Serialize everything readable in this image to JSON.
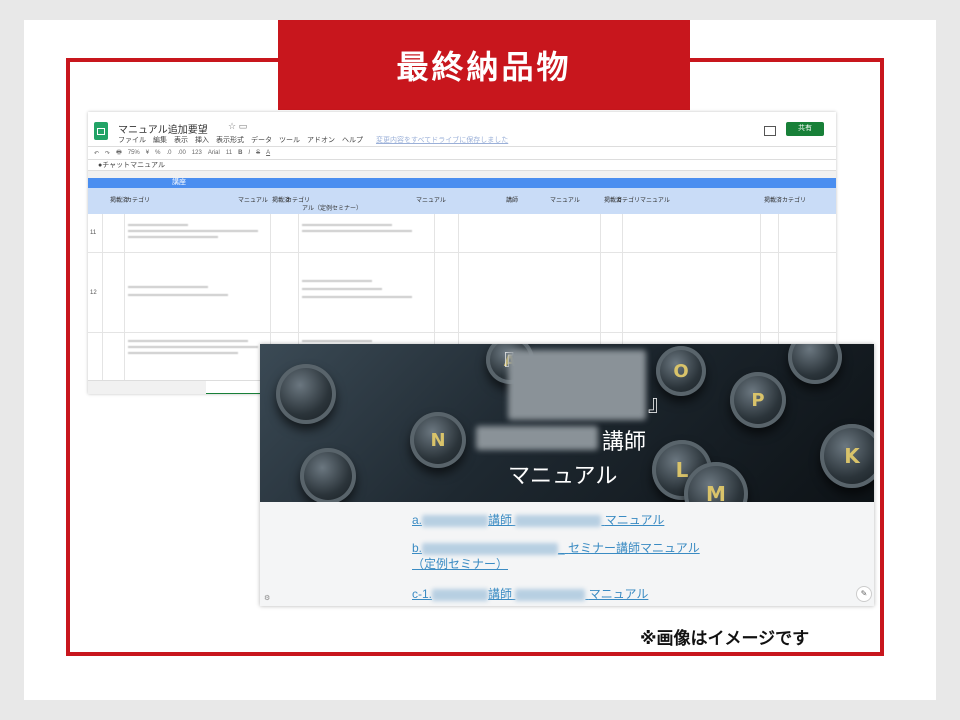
{
  "slide": {
    "title": "最終納品物",
    "note": "※画像はイメージです",
    "colors": {
      "accent": "#c8161d",
      "sheet_blue": "#4a8ef0",
      "link": "#3a8bc3"
    }
  },
  "spreadsheet": {
    "doc_title": "マニュアル追加要望",
    "menu": [
      "ファイル",
      "編集",
      "表示",
      "挿入",
      "表示形式",
      "データ",
      "ツール",
      "アドオン",
      "ヘルプ"
    ],
    "save_note": "変更内容をすべてドライブに保存しました",
    "share_label": "共有",
    "toolbar_items": [
      "↶",
      "↷",
      "🖶",
      "75%",
      "¥",
      "%",
      ".0",
      ".00",
      "123",
      "Arial",
      "11",
      "B",
      "I",
      "S",
      "A"
    ],
    "formula_text": "●チャットマニュアル",
    "section_row": "講座",
    "header_cells": [
      "掲載済",
      "カテゴリ",
      "マニュアル",
      "掲載済",
      "カテゴリ",
      "マニュアル",
      "講師",
      "マニュアル",
      "掲載済",
      "カテゴリ",
      "マニュアル",
      "掲載済",
      "カテゴリ"
    ],
    "header_subtitle": "アル（定例セミナー）",
    "row_numbers": [
      "11",
      "12"
    ]
  },
  "website": {
    "hero_line1_open": "『",
    "hero_line1_close": "』",
    "hero_line2": "講師",
    "hero_line3": "マニュアル",
    "keys": [
      "O",
      "P",
      "L",
      "A",
      "N",
      "M",
      "K"
    ],
    "links": [
      {
        "prefix": "a.",
        "mid": "講師",
        "suffix": "マニュアル"
      },
      {
        "prefix": "b.",
        "mid": "_",
        "suffix": "セミナー講師マニュアル",
        "line2": "（定例セミナー）"
      },
      {
        "prefix": "c-1.",
        "mid": "講師",
        "suffix": "マニュアル"
      }
    ],
    "edit_icon": "pencil-icon"
  }
}
